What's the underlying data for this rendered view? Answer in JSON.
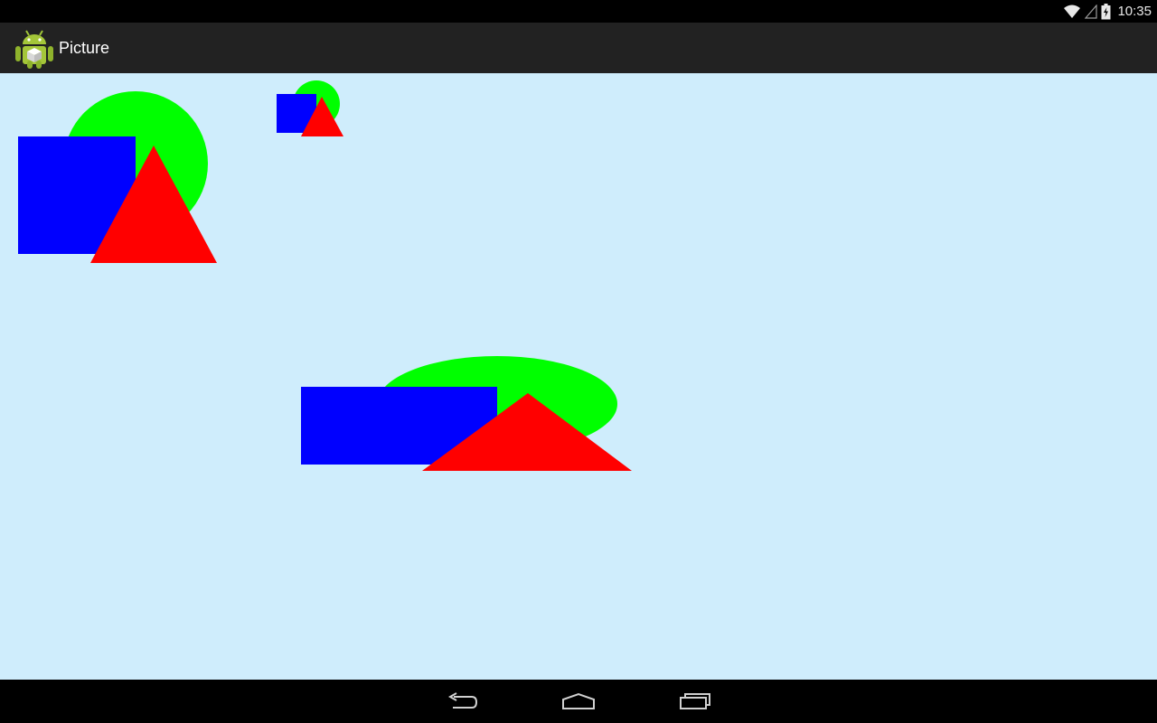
{
  "status_bar": {
    "time": "10:35",
    "icons": [
      "wifi-icon",
      "signal-icon",
      "battery-charging-icon"
    ]
  },
  "action_bar": {
    "title": "Picture",
    "app_icon": "android-robot-icon"
  },
  "canvas": {
    "background": "#cfedfc",
    "shape_colors": {
      "circle": "#00ff00",
      "square": "#0000ff",
      "triangle": "#ff0000"
    }
  },
  "nav_bar": {
    "buttons": [
      "back-icon",
      "home-icon",
      "recent-apps-icon"
    ]
  }
}
